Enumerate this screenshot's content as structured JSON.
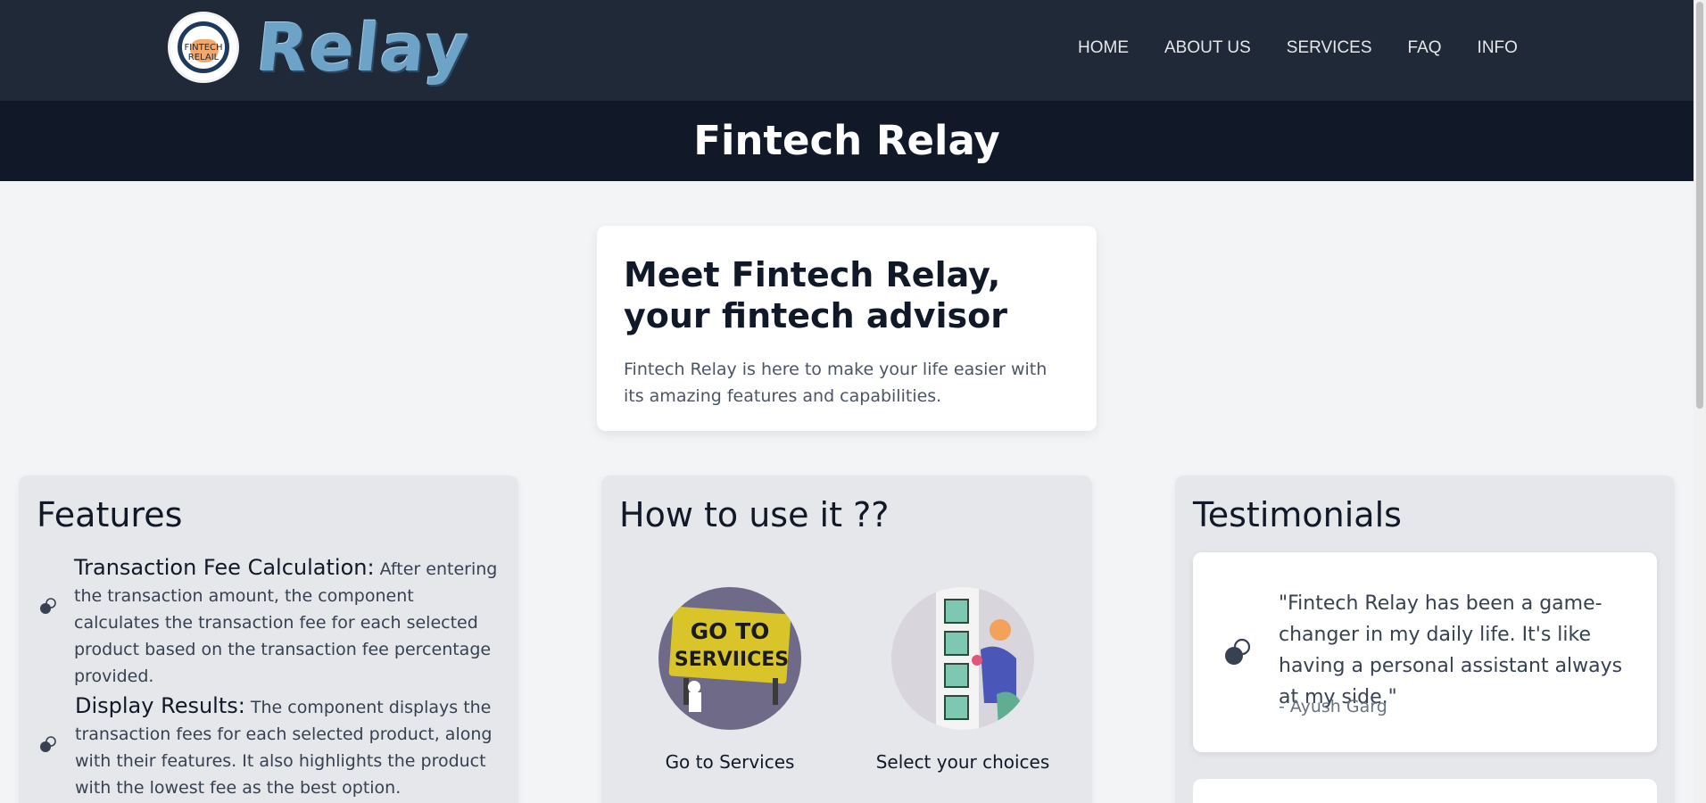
{
  "brand": {
    "logo_text": "FINTECH RELAIL",
    "wordmark": "Relay"
  },
  "nav": {
    "items": [
      {
        "label": "HOME"
      },
      {
        "label": "ABOUT US"
      },
      {
        "label": "SERVICES"
      },
      {
        "label": "FAQ"
      },
      {
        "label": "INFO"
      }
    ]
  },
  "page": {
    "title": "Fintech Relay"
  },
  "hero": {
    "heading": "Meet Fintech Relay, your fintech advisor",
    "body": "Fintech Relay is here to make your life easier with its amazing features and capabilities."
  },
  "features": {
    "heading": "Features",
    "items": [
      {
        "title": "Transaction Fee Calculation:",
        "text": " After entering the transaction amount, the component calculates the transaction fee for each selected product based on the transaction fee percentage provided.",
        "icon": "link-icon"
      },
      {
        "title": "Display Results:",
        "text": " The component displays the transaction fees for each selected product, along with their features. It also highlights the product with the lowest fee as the best option.",
        "icon": "link-icon"
      }
    ]
  },
  "howto": {
    "heading": "How to use it ??",
    "steps": [
      {
        "caption": "Go to Services",
        "image_text": "GO TO SERVIICES"
      },
      {
        "caption": "Select your choices"
      }
    ]
  },
  "testimonials": {
    "heading": "Testimonials",
    "items": [
      {
        "quote": "\"Fintech Relay has been a game-changer in my daily life. It's like having a personal assistant always at my side.\"",
        "author": "- Ayush Garg",
        "icon": "link-icon"
      }
    ]
  },
  "colors": {
    "navbar": "#1f2937",
    "title_band": "#111827",
    "page_bg": "#f3f4f6",
    "panel_bg": "#e5e7eb",
    "card_bg": "#ffffff"
  }
}
